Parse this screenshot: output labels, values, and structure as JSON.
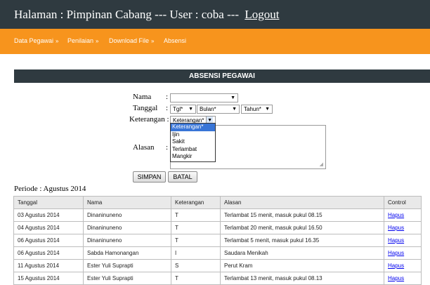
{
  "header": {
    "title": "Halaman : Pimpinan Cabang --- User : coba ---",
    "logout": "Logout"
  },
  "nav": {
    "items": [
      {
        "label": "Data Pegawai"
      },
      {
        "label": "Penilaian"
      },
      {
        "label": "Download File"
      },
      {
        "label": "Absensi"
      }
    ],
    "arrow": "»"
  },
  "form": {
    "heading": "ABSENSI PEGAWAI",
    "nama_label": "Nama",
    "tanggal_label": "Tanggal",
    "keterangan_label": "Keterangan",
    "alasan_label": "Alasan",
    "colon": ":",
    "nama_value": "",
    "tgl_value": "Tgl*",
    "bulan_value": "Bulan*",
    "tahun_value": "Tahun*",
    "keterangan_value": "Keterangan*",
    "keterangan_options": [
      "Keterangan*",
      "Ijin",
      "Sakit",
      "Terlambat",
      "Mangkir"
    ],
    "simpan": "SIMPAN",
    "batal": "BATAL"
  },
  "periode": "Periode : Agustus 2014",
  "table": {
    "columns": [
      "Tanggal",
      "Nama",
      "Keterangan",
      "Alasan",
      "Control"
    ],
    "rows": [
      [
        "03 Agustus 2014",
        "Dinaninuneno",
        "T",
        "Terlambat 15 menit, masuk pukul 08.15",
        "Hapus"
      ],
      [
        "04 Agustus 2014",
        "Dinaninuneno",
        "T",
        "Terlambat 20 menit, masuk pukul 16.50",
        "Hapus"
      ],
      [
        "06 Agustus 2014",
        "Dinaninuneno",
        "T",
        "Terlambat 5 menit, masuk pukul 16.35",
        "Hapus"
      ],
      [
        "06 Agustus 2014",
        "Sabda Hamonangan",
        "I",
        "Saudara Menikah",
        "Hapus"
      ],
      [
        "11 Agustus 2014",
        "Ester Yuli Suprapti",
        "S",
        "Perut Kram",
        "Hapus"
      ],
      [
        "15 Agustus 2014",
        "Ester Yuli Suprapti",
        "T",
        "Terlambat 13 menit, masuk pukul 08.13",
        "Hapus"
      ]
    ]
  },
  "colors": {
    "header_bg": "#2f3a40",
    "nav_bg": "#f7941d",
    "select_highlight": "#3875d7",
    "link": "#0000ee"
  },
  "icons": {
    "dropdown": "chevron-down-icon",
    "resize": "resize-grip-icon"
  }
}
